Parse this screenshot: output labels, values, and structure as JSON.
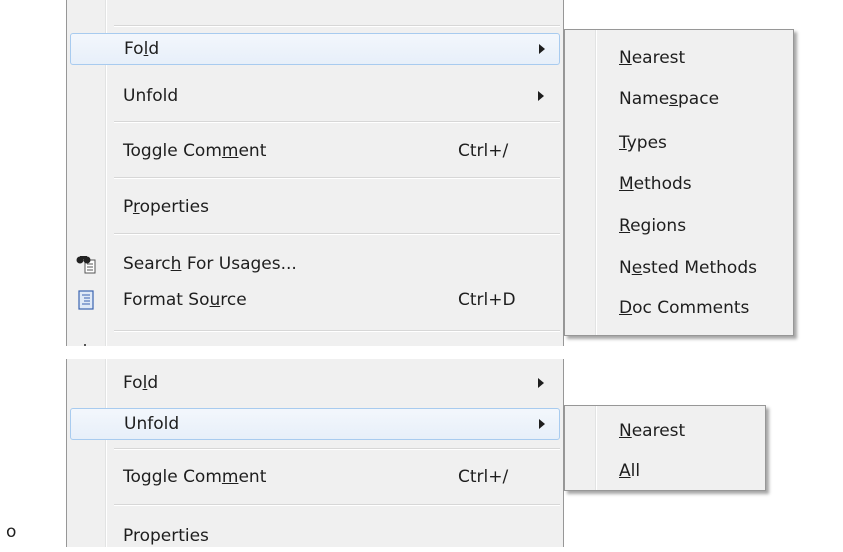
{
  "menu1": {
    "items": [
      {
        "pre": "Fo",
        "acc": "l",
        "post": "d",
        "shortcut": "",
        "submenu": true,
        "highlighted": true
      },
      {
        "pre": "",
        "acc": "",
        "post": "Unfold",
        "shortcut": "",
        "submenu": true,
        "highlighted": false
      },
      {
        "pre": "Toggle Com",
        "acc": "m",
        "post": "ent",
        "shortcut": "Ctrl+/",
        "submenu": false,
        "highlighted": false
      },
      {
        "pre": "P",
        "acc": "r",
        "post": "operties",
        "shortcut": "",
        "submenu": false,
        "highlighted": false
      },
      {
        "pre": "Searc",
        "acc": "h",
        "post": " For Usages...",
        "shortcut": "",
        "submenu": false,
        "highlighted": false,
        "icon": "binoculars-icon"
      },
      {
        "pre": "Format So",
        "acc": "u",
        "post": "rce",
        "shortcut": "Ctrl+D",
        "submenu": false,
        "highlighted": false,
        "icon": "format-document-icon"
      }
    ]
  },
  "submenu1": {
    "items": [
      {
        "pre": "",
        "acc": "N",
        "post": "earest"
      },
      {
        "pre": "Name",
        "acc": "s",
        "post": "pace"
      },
      {
        "pre": "",
        "acc": "T",
        "post": "ypes"
      },
      {
        "pre": "",
        "acc": "M",
        "post": "ethods"
      },
      {
        "pre": "",
        "acc": "R",
        "post": "egions"
      },
      {
        "pre": "N",
        "acc": "e",
        "post": "sted Methods"
      },
      {
        "pre": "",
        "acc": "D",
        "post": "oc Comments"
      }
    ]
  },
  "menu2": {
    "items": [
      {
        "pre": "Fo",
        "acc": "l",
        "post": "d",
        "shortcut": "",
        "submenu": true,
        "highlighted": false
      },
      {
        "pre": "",
        "acc": "",
        "post": "Unfold",
        "shortcut": "",
        "submenu": true,
        "highlighted": true
      },
      {
        "pre": "Toggle Com",
        "acc": "m",
        "post": "ent",
        "shortcut": "Ctrl+/",
        "submenu": false,
        "highlighted": false
      },
      {
        "pre": "",
        "acc": "",
        "post": "Properties",
        "shortcut": "",
        "submenu": false,
        "highlighted": false
      }
    ]
  },
  "submenu2": {
    "items": [
      {
        "pre": "",
        "acc": "N",
        "post": "earest"
      },
      {
        "pre": "",
        "acc": "A",
        "post": "ll"
      }
    ]
  },
  "stray_text": "o",
  "colors": {
    "highlight_border": "#a8cbef",
    "menu_bg": "#f0f0f0"
  }
}
